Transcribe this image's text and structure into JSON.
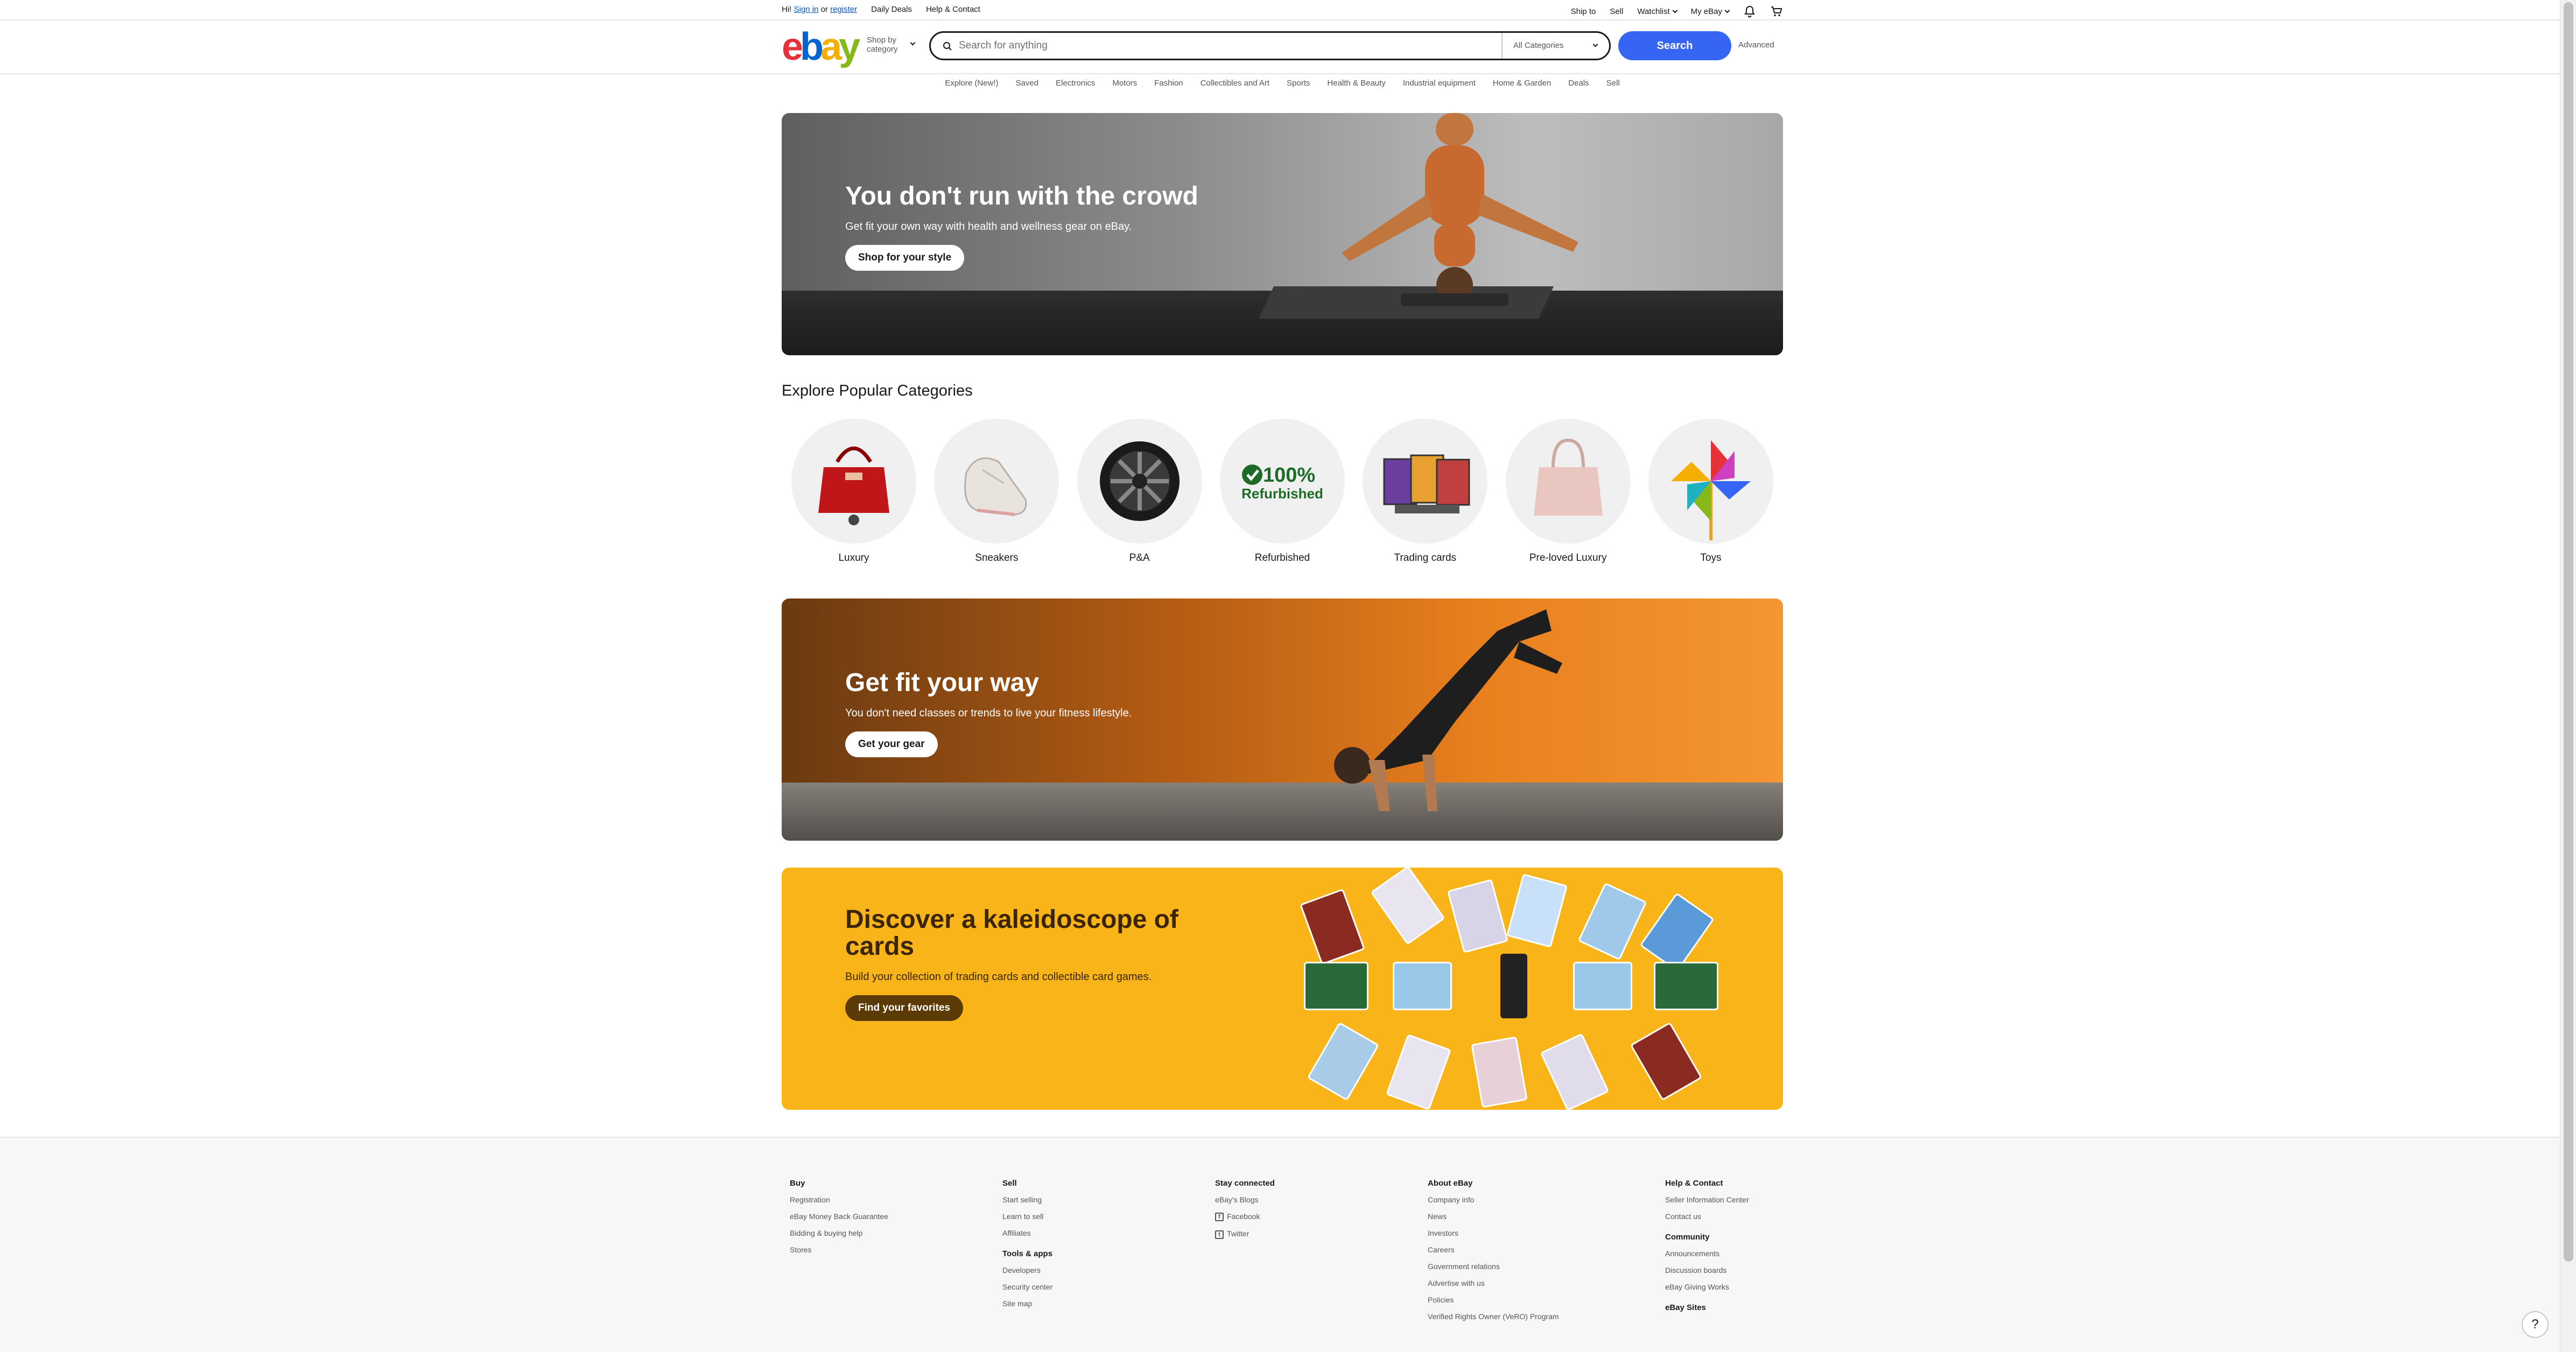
{
  "topbar": {
    "greeting_prefix": "Hi!",
    "sign_in": "Sign in",
    "or": "or",
    "register": "register",
    "daily_deals": "Daily Deals",
    "help_contact": "Help & Contact",
    "ship_to": "Ship to",
    "sell": "Sell",
    "watchlist": "Watchlist",
    "my_ebay": "My eBay"
  },
  "header": {
    "logo": {
      "e": "e",
      "b": "b",
      "a": "a",
      "y": "y"
    },
    "shop_by_line1": "Shop by",
    "shop_by_line2": "category",
    "search_placeholder": "Search for anything",
    "category_select": "All Categories",
    "search_button": "Search",
    "advanced": "Advanced"
  },
  "nav": [
    "Explore (New!)",
    "Saved",
    "Electronics",
    "Motors",
    "Fashion",
    "Collectibles and Art",
    "Sports",
    "Health & Beauty",
    "Industrial equipment",
    "Home & Garden",
    "Deals",
    "Sell"
  ],
  "banners": {
    "b1": {
      "title": "You don't run with the crowd",
      "subtitle": "Get fit your own way with health and wellness gear on eBay.",
      "button": "Shop for your style"
    },
    "b2": {
      "title": "Get fit your way",
      "subtitle": "You don't need classes or trends to live your fitness lifestyle.",
      "button": "Get your gear"
    },
    "b3": {
      "title": "Discover a kaleidoscope of cards",
      "subtitle": "Build your collection of trading cards and collectible card games.",
      "button": "Find your favorites"
    }
  },
  "categories": {
    "title": "Explore Popular Categories",
    "refurb_badge_pct": "100%",
    "refurb_badge_label": "Refurbished",
    "items": [
      "Luxury",
      "Sneakers",
      "P&A",
      "Refurbished",
      "Trading cards",
      "Pre-loved Luxury",
      "Toys"
    ]
  },
  "footer": {
    "buy": {
      "title": "Buy",
      "links": [
        "Registration",
        "eBay Money Back Guarantee",
        "Bidding & buying help",
        "Stores"
      ]
    },
    "sell": {
      "title": "Sell",
      "links": [
        "Start selling",
        "Learn to sell",
        "Affiliates"
      ]
    },
    "tools": {
      "title": "Tools & apps",
      "links": [
        "Developers",
        "Security center",
        "Site map"
      ]
    },
    "stay": {
      "title": "Stay connected",
      "links": [
        "eBay's Blogs",
        "Facebook",
        "Twitter"
      ]
    },
    "about": {
      "title": "About eBay",
      "links": [
        "Company info",
        "News",
        "Investors",
        "Careers",
        "Government relations",
        "Advertise with us",
        "Policies",
        "Verified Rights Owner (VeRO) Program"
      ]
    },
    "help": {
      "title": "Help & Contact",
      "links": [
        "Seller Information Center",
        "Contact us"
      ]
    },
    "community": {
      "title": "Community",
      "links": [
        "Announcements",
        "Discussion boards",
        "eBay Giving Works"
      ]
    },
    "sites": {
      "title": "eBay Sites"
    },
    "help_fab": "?"
  },
  "colors": {
    "brand_blue": "#3665f3",
    "ebay_red": "#e53238",
    "ebay_blue": "#0064d2",
    "ebay_yellow": "#f5af02",
    "ebay_green": "#86b817",
    "cards_yellow": "#f8b418"
  }
}
